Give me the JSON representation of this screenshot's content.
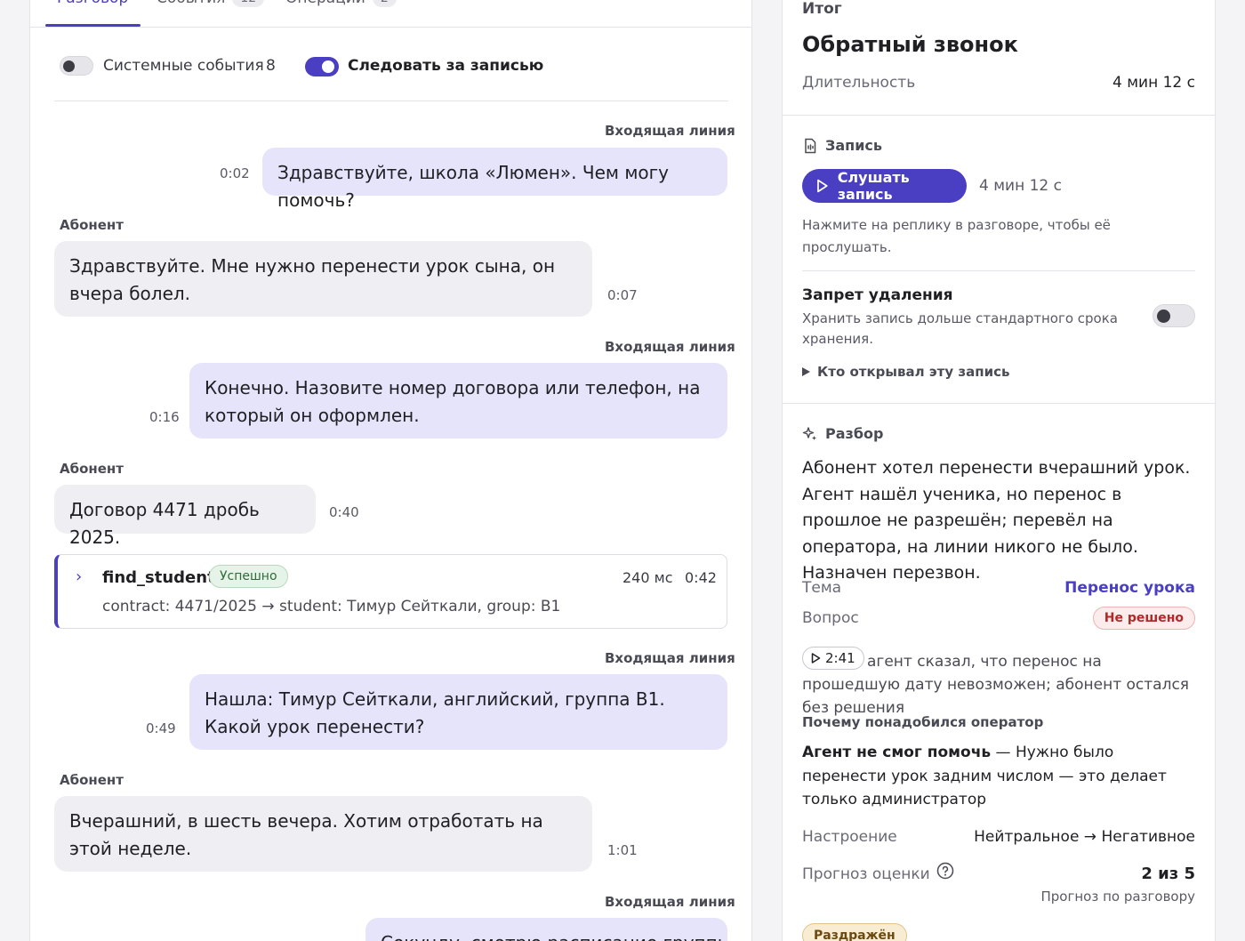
{
  "tabs": [
    {
      "label": "Разговор",
      "count": ""
    },
    {
      "label": "События",
      "count": "12"
    },
    {
      "label": "Операции",
      "count": "2"
    }
  ],
  "controls": {
    "system_events_label": "Системные события",
    "system_events_count": "8",
    "system_events_on": false,
    "follow_label": "Следовать за записью",
    "follow_on": true
  },
  "transcript": [
    {
      "speaker": "Входящая линия",
      "text": "Здравствуйте, школа «Люмен». Чем могу помочь?",
      "time": "0:02"
    },
    {
      "speaker": "Абонент",
      "text": "Здравствуйте. Мне нужно перенести урок сына, он вчера болел.",
      "time": "0:07"
    },
    {
      "speaker": "Входящая линия",
      "text": "Конечно. Назовите номер договора или телефон, на который он оформлен.",
      "time": "0:16"
    },
    {
      "speaker": "Абонент",
      "text": "Договор 4471 дробь 2025.",
      "time": "0:40"
    },
    {
      "speaker": "Входящая линия",
      "text": "Нашла: Тимур Сейткали, английский, группа B1. Какой урок перенести?",
      "time": "0:49"
    },
    {
      "speaker": "Абонент",
      "text": "Вчерашний, в шесть вечера. Хотим отработать на этой неделе.",
      "time": "1:01"
    },
    {
      "speaker": "Входящая линия",
      "text": "Секунду, смотрю расписание группы",
      "time": ""
    }
  ],
  "tool_call": {
    "name": "find_student",
    "status": "Успешно",
    "duration": "240 мс",
    "time": "0:42",
    "detail": "contract: 4471/2025 → student: Тимур Сейткали, group: B1"
  },
  "summary": {
    "section_label": "Итог",
    "title": "Обратный звонок",
    "duration_label": "Длительность",
    "duration_value": "4 мин 12 с"
  },
  "recording": {
    "title": "Запись",
    "play_label": "Слушать запись",
    "length": "4 мин 12 с",
    "hint": "Нажмите на реплику в разговоре, чтобы её прослушать.",
    "lock_title": "Запрет удаления",
    "lock_desc": "Хранить запись дольше стандартного срока хранения.",
    "lock_on": false,
    "access_log_label": "Кто открывал эту запись"
  },
  "analysis": {
    "title": "Разбор",
    "text": "Абонент хотел перенести вчерашний урок. Агент нашёл ученика, но перенос в прошлое не разрешён; перевёл на оператора, на линии никого не было. Назначен перезвон.",
    "topic_label": "Тема",
    "topic_value": "Перенос урока",
    "question_label": "Вопрос",
    "question_status": "Не решено",
    "quote_time": "2:41",
    "quote_text": "агент сказал, что перенос на прошедшую дату невозможен; абонент остался без решения",
    "why_operator_label": "Почему понадобился оператор",
    "why_operator_bold": "Агент не смог помочь",
    "why_operator_text": " — Нужно было перенести урок задним числом — это делает только администратор",
    "mood_label": "Настроение",
    "mood_value": "Нейтральное → Негативное",
    "score_label": "Прогноз оценки",
    "score_value": "2 из 5",
    "score_note": "Прогноз по разговору",
    "emotion_badge": "Раздражён"
  },
  "colors": {
    "accent": "#4a3fc2",
    "agent_bubble": "#e6e4fb",
    "user_bubble": "#efeff3",
    "success": "#2f6b3a",
    "danger": "#b02a2a"
  }
}
